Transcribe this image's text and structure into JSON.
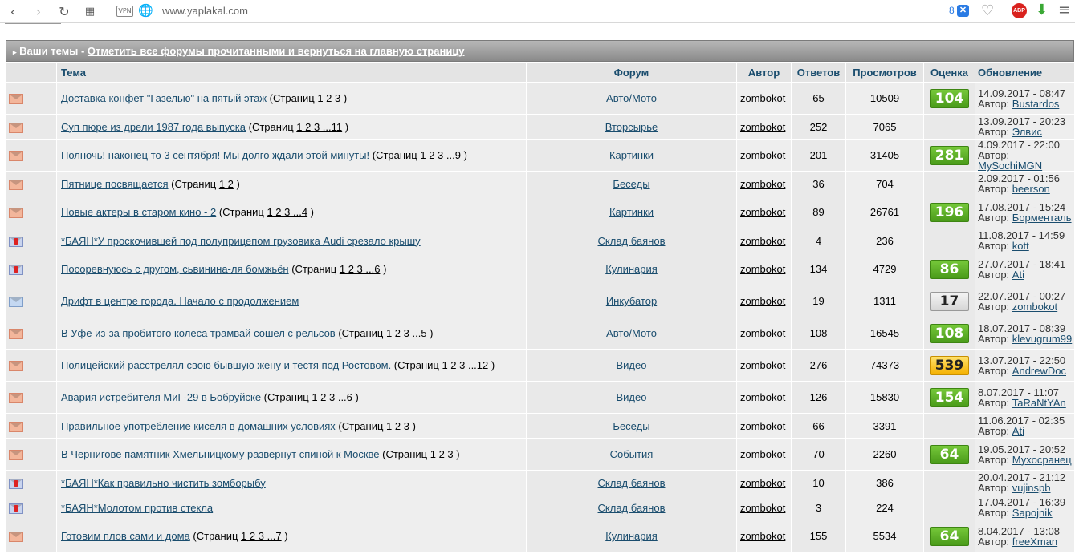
{
  "browser": {
    "url": "www.yaplakal.com",
    "vpn_label": "VPN",
    "ext_count": "8",
    "abp_label": "ABP"
  },
  "forum": {
    "title_prefix": "Ваши темы",
    "title_separator": " - ",
    "title_link": "Отметить все форумы прочитанными и вернуться на главную страницу",
    "columns": {
      "topic": "Тема",
      "forum": "Форум",
      "author": "Автор",
      "replies": "Ответов",
      "views": "Просмотров",
      "rating": "Оценка",
      "update": "Обновление"
    },
    "pages_prefix": "(Страниц",
    "pages_suffix": ")",
    "author_prefix": "Автор:",
    "topics": [
      {
        "icon": "orange",
        "title": "Доставка конфет \"Газелью\" на пятый этаж",
        "pages": "1 2 3",
        "forum": "Авто/Мото",
        "author": "zombokot",
        "replies": "65",
        "views": "10509",
        "rating": "104",
        "rating_color": "green",
        "date": "14.09.2017 - 08:47",
        "last_author": "Bustardos"
      },
      {
        "icon": "orange",
        "title": "Суп пюре из дрели 1987 года выпуска",
        "pages": "1 2 3 ...11",
        "forum": "Вторсырье",
        "author": "zombokot",
        "replies": "252",
        "views": "7065",
        "rating": "",
        "rating_color": "",
        "date": "13.09.2017 - 20:23",
        "last_author": "Элвис"
      },
      {
        "icon": "orange",
        "title": "Полночь! наконец то 3 сентября! Мы долго ждали этой минуты!",
        "pages": "1 2 3 ...9",
        "forum": "Картинки",
        "author": "zombokot",
        "replies": "201",
        "views": "31405",
        "rating": "281",
        "rating_color": "green",
        "date": "4.09.2017 - 22:00",
        "last_author": "MySochiMGN"
      },
      {
        "icon": "orange",
        "title": "Пятнице посвящается",
        "pages": "1 2",
        "forum": "Беседы",
        "author": "zombokot",
        "replies": "36",
        "views": "704",
        "rating": "",
        "rating_color": "",
        "date": "2.09.2017 - 01:56",
        "last_author": "beerson"
      },
      {
        "icon": "orange",
        "title": "Новые актеры в старом кино - 2",
        "pages": "1 2 3 ...4",
        "forum": "Картинки",
        "author": "zombokot",
        "replies": "89",
        "views": "26761",
        "rating": "196",
        "rating_color": "green",
        "date": "17.08.2017 - 15:24",
        "last_author": "Борменталь"
      },
      {
        "icon": "red",
        "title": "*БАЯН*У проскочившей под полуприцепом грузовика Audi срезало крышу",
        "pages": "",
        "forum": "Склад баянов",
        "author": "zombokot",
        "replies": "4",
        "views": "236",
        "rating": "",
        "rating_color": "",
        "date": "11.08.2017 - 14:59",
        "last_author": "kott"
      },
      {
        "icon": "red",
        "title": "Посоревнуюсь с другом, сьвинина-ля бомжьён",
        "pages": "1 2 3 ...6",
        "forum": "Кулинария",
        "author": "zombokot",
        "replies": "134",
        "views": "4729",
        "rating": "86",
        "rating_color": "green",
        "date": "27.07.2017 - 18:41",
        "last_author": "Ati"
      },
      {
        "icon": "blue",
        "title": "Дрифт в центре города. Начало с продолжением",
        "pages": "",
        "forum": "Инкубатор",
        "author": "zombokot",
        "replies": "19",
        "views": "1311",
        "rating": "17",
        "rating_color": "gray",
        "date": "22.07.2017 - 00:27",
        "last_author": "zombokot"
      },
      {
        "icon": "orange",
        "title": "В Уфе из-за пробитого колеса трамвай сошел с рельсов",
        "pages": "1 2 3 ...5",
        "forum": "Авто/Мото",
        "author": "zombokot",
        "replies": "108",
        "views": "16545",
        "rating": "108",
        "rating_color": "green",
        "date": "18.07.2017 - 08:39",
        "last_author": "klevugrum99"
      },
      {
        "icon": "orange",
        "title": "Полицейский расстрелял свою бывшую жену и тестя под Ростовом.",
        "pages": "1 2 3 ...12",
        "forum": "Видео",
        "author": "zombokot",
        "replies": "276",
        "views": "74373",
        "rating": "539",
        "rating_color": "yellow",
        "date": "13.07.2017 - 22:50",
        "last_author": "AndrewDoc"
      },
      {
        "icon": "orange",
        "title": "Авария истребителя МиГ-29 в Бобруйске",
        "pages": "1 2 3 ...6",
        "forum": "Видео",
        "author": "zombokot",
        "replies": "126",
        "views": "15830",
        "rating": "154",
        "rating_color": "green",
        "date": "8.07.2017 - 11:07",
        "last_author": "TaRaNtYAn"
      },
      {
        "icon": "orange",
        "title": "Правильное употребление киселя в домашних условиях",
        "pages": "1 2 3",
        "forum": "Беседы",
        "author": "zombokot",
        "replies": "66",
        "views": "3391",
        "rating": "",
        "rating_color": "",
        "date": "11.06.2017 - 02:35",
        "last_author": "Ati"
      },
      {
        "icon": "orange",
        "title": "В Чернигове памятник Хмельницкому развернут спиной к Москве",
        "pages": "1 2 3",
        "forum": "События",
        "author": "zombokot",
        "replies": "70",
        "views": "2260",
        "rating": "64",
        "rating_color": "green",
        "date": "19.05.2017 - 20:52",
        "last_author": "Мухосранец"
      },
      {
        "icon": "red",
        "title": "*БАЯН*Как правильно чистить зомборыбу",
        "pages": "",
        "forum": "Склад баянов",
        "author": "zombokot",
        "replies": "10",
        "views": "386",
        "rating": "",
        "rating_color": "",
        "date": "20.04.2017 - 21:12",
        "last_author": "vujinspb"
      },
      {
        "icon": "red",
        "title": "*БАЯН*Молотом против стекла",
        "pages": "",
        "forum": "Склад баянов",
        "author": "zombokot",
        "replies": "3",
        "views": "224",
        "rating": "",
        "rating_color": "",
        "date": "17.04.2017 - 16:39",
        "last_author": "Sapojnik"
      },
      {
        "icon": "orange",
        "title": "Готовим плов сами и дома",
        "pages": "1 2 3 ...7",
        "forum": "Кулинария",
        "author": "zombokot",
        "replies": "155",
        "views": "5534",
        "rating": "64",
        "rating_color": "green",
        "date": "8.04.2017 - 13:08",
        "last_author": "freeXman"
      }
    ]
  }
}
